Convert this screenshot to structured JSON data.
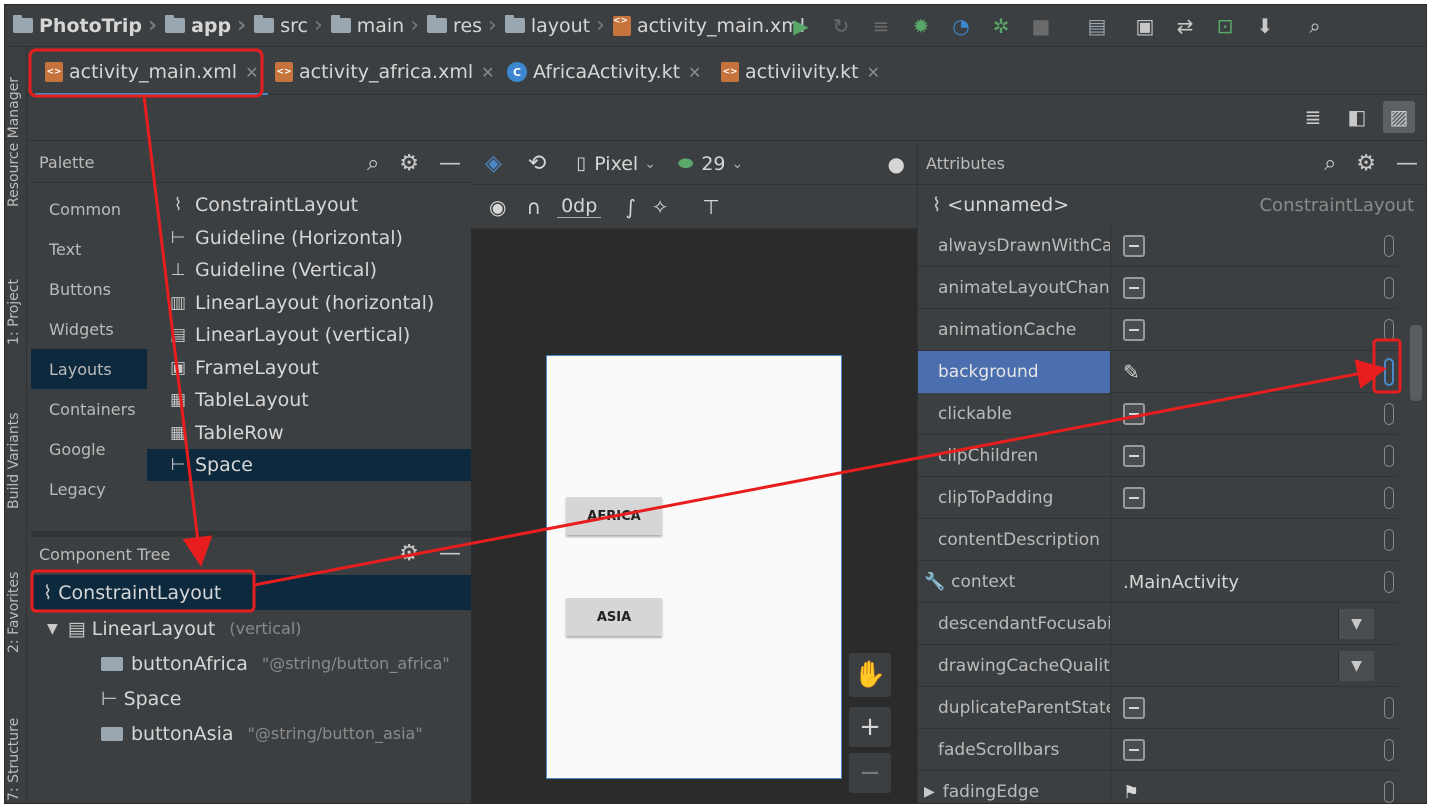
{
  "breadcrumb": {
    "project": "PhotoTrip",
    "items": [
      "app",
      "src",
      "main",
      "res",
      "layout",
      "activity_main.xml"
    ]
  },
  "left_tool_windows": [
    "Resource Manager",
    "1: Project",
    "Build Variants",
    "2: Favorites",
    "7: Structure"
  ],
  "tabs": [
    {
      "label": "activity_main.xml",
      "type": "xml",
      "active": true
    },
    {
      "label": "activity_africa.xml",
      "type": "xml",
      "active": false
    },
    {
      "label": "AfricaActivity.kt",
      "type": "kotlin",
      "active": false
    },
    {
      "label": "activiivity.kt",
      "type": "xml",
      "active": false
    }
  ],
  "palette": {
    "title": "Palette",
    "categories": [
      "Common",
      "Text",
      "Buttons",
      "Widgets",
      "Layouts",
      "Containers",
      "Google",
      "Legacy"
    ],
    "selected_category": "Layouts",
    "items": [
      "ConstraintLayout",
      "Guideline (Horizontal)",
      "Guideline (Vertical)",
      "LinearLayout (horizontal)",
      "LinearLayout (vertical)",
      "FrameLayout",
      "TableLayout",
      "TableRow",
      "Space"
    ],
    "selected_item": "Space"
  },
  "component_tree": {
    "title": "Component Tree",
    "rows": [
      {
        "label": "ConstraintLayout",
        "sub": ""
      },
      {
        "label": "LinearLayout",
        "sub": "(vertical)"
      },
      {
        "label": "buttonAfrica",
        "sub": "\"@string/button_africa\""
      },
      {
        "label": "Space",
        "sub": ""
      },
      {
        "label": "buttonAsia",
        "sub": "\"@string/button_asia\""
      }
    ]
  },
  "design": {
    "device": "Pixel",
    "api": "29",
    "margin": "0dp",
    "buttons": [
      "AFRICA",
      "ASIA"
    ],
    "zoom_in": "+",
    "zoom_out": "−"
  },
  "attributes": {
    "title": "Attributes",
    "component_id": "<unnamed>",
    "component_type": "ConstraintLayout",
    "rows": [
      {
        "name": "alwaysDrawnWithCa...",
        "value": ""
      },
      {
        "name": "animateLayoutChan...",
        "value": ""
      },
      {
        "name": "animationCache",
        "value": ""
      },
      {
        "name": "background",
        "value": ""
      },
      {
        "name": "clickable",
        "value": ""
      },
      {
        "name": "clipChildren",
        "value": ""
      },
      {
        "name": "clipToPadding",
        "value": ""
      },
      {
        "name": "contentDescription",
        "value": ""
      },
      {
        "name": "context",
        "value": ".MainActivity"
      },
      {
        "name": "descendantFocusabil...",
        "value": ""
      },
      {
        "name": "drawingCacheQuality",
        "value": ""
      },
      {
        "name": "duplicateParentState",
        "value": ""
      },
      {
        "name": "fadeScrollbars",
        "value": ""
      },
      {
        "name": "fadingEdge",
        "value": ""
      }
    ],
    "selected": "background"
  },
  "colors": {
    "panel": "#3c3f41",
    "selection": "#0d293e",
    "attr_selection": "#4b6eaf",
    "annotation": "#e81e1e"
  }
}
